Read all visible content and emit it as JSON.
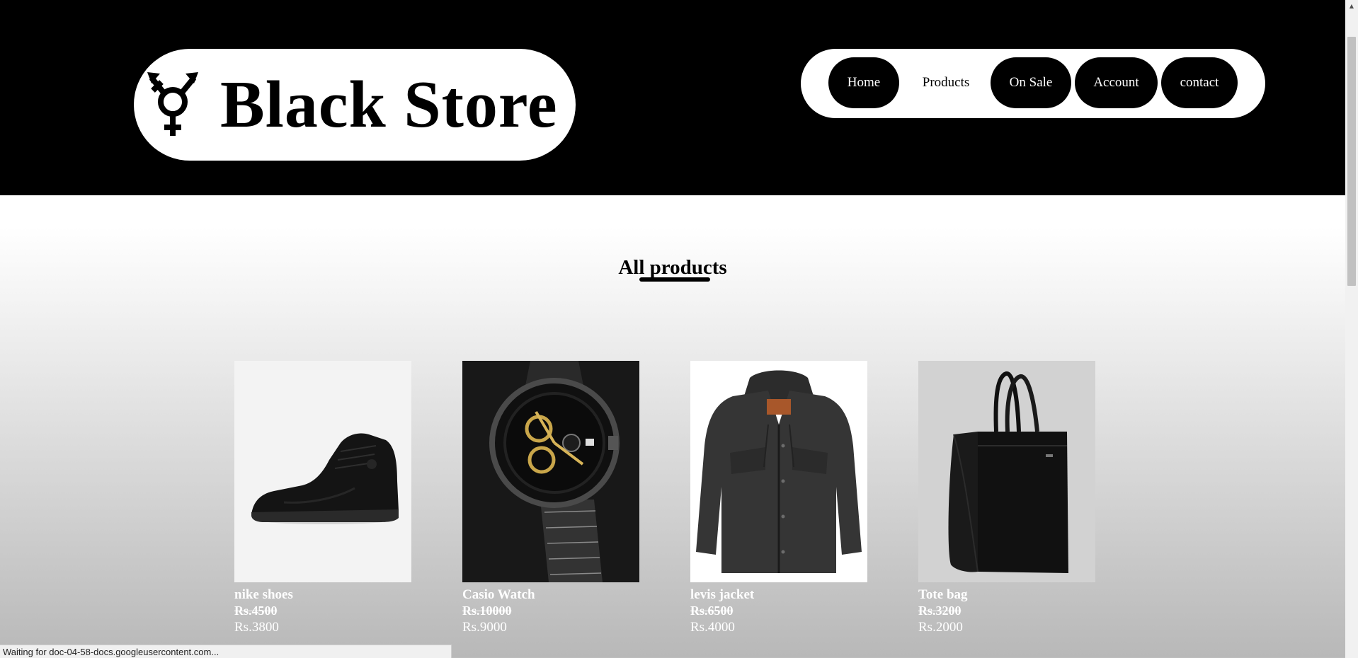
{
  "logo": {
    "text": "Black Store",
    "icon": "transgender-symbol-icon"
  },
  "nav": [
    {
      "label": "Home"
    },
    {
      "label": "Products"
    },
    {
      "label": "On Sale"
    },
    {
      "label": "Account"
    },
    {
      "label": "contact"
    }
  ],
  "main": {
    "title": "All products"
  },
  "products": [
    {
      "name": "nike shoes",
      "old_price": "Rs.4500",
      "price": "Rs.3800",
      "image": "black-sneaker-image"
    },
    {
      "name": "Casio Watch",
      "old_price": "Rs.10000",
      "price": "Rs.9000",
      "image": "black-wristwatch-image"
    },
    {
      "name": "levis jacket",
      "old_price": "Rs.6500",
      "price": "Rs.4000",
      "image": "denim-jacket-image"
    },
    {
      "name": "Tote bag",
      "old_price": "Rs.3200",
      "price": "Rs.2000",
      "image": "black-tote-bag-image"
    }
  ],
  "status_bar": {
    "text": "Waiting for doc-04-58-docs.googleusercontent.com..."
  },
  "colors": {
    "header_bg": "#000000",
    "accent": "#000000",
    "text_on_dark": "#ffffff"
  }
}
